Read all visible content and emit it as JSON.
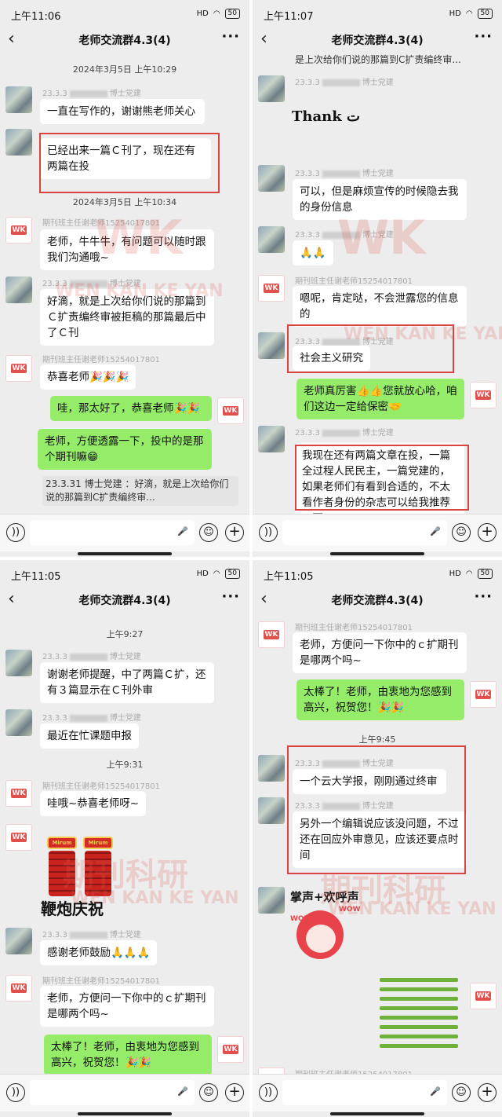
{
  "status": {
    "p1_time": "上午11:06",
    "p2_time": "上午11:07",
    "p3_time": "上午11:05",
    "p4_time": "上午11:05",
    "battery": "50",
    "net": "HD"
  },
  "header": {
    "title": "老师交流群4.3(4)",
    "back": "‹",
    "more": "···"
  },
  "input": {
    "mic": "🎤",
    "emoji": "☺",
    "plus": "+",
    "voice": "))"
  },
  "watermark": {
    "wk": "WK",
    "pinyin": "WEN KAN KE YAN",
    "cn": "期刊科研",
    "logo": "WK"
  },
  "sender_names": {
    "member": "23.3.3",
    "member_suffix": "博士党建",
    "teacher": "期刊班主任谢老师15254017801",
    "teacher_short": "期刊班主任谢老师"
  },
  "p1": {
    "ts1": "2024年3月5日 上午10:29",
    "m1": "一直在写作的，谢谢熊老师关心",
    "m2": "已经出来一篇Ｃ刊了，现在还有两篇在投",
    "ts2": "2024年3月5日 上午10:34",
    "m3": "老师，牛牛牛，有问题可以随时跟我们沟通哦~",
    "m4": "好滴，就是上次给你们说的那篇到Ｃ扩责编终审被拒稿的那篇最后中了Ｃ刊",
    "m5": "恭喜老师🎉🎉🎉",
    "m6": "哇，那太好了，恭喜老师🎉🎉",
    "m7": "老师，方便透露一下，投中的是那个期刊嘛😁",
    "quote": "23.3.31  博士党建  ：好滴，就是上次给你们说的那篇到C扩责编终审..."
  },
  "p2": {
    "top_quote": "是上次给你们说的那篇到C扩责编终审...",
    "sticker": "Thank ت",
    "m1": "可以，但是麻烦宣传的时候隐去我的身份信息",
    "m2": "🙏🙏",
    "m3": "嗯呢，肯定哒，不会泄露您的信息的",
    "m4": "社会主义研究",
    "m5": "老师真厉害👍👍您就放心哈，咱们这边一定给保密🤝",
    "m6": "我现在还有两篇文章在投，一篇全过程人民民主，一篇党建的，如果老师们有看到合适的，不太看作者身份的杂志可以给我推荐一下"
  },
  "p3": {
    "ts1": "上午9:27",
    "m1": "谢谢老师提醒，中了两篇Ｃ扩，还有３篇显示在Ｃ刊外审",
    "m2": "最近在忙课题申报",
    "ts2": "上午9:31",
    "m3": "哇哦~恭喜老师呀~",
    "sticker": "鞭炮庆祝",
    "fc_label": "Mirum",
    "m4": "感谢老师鼓励🙏🙏🙏",
    "m5": "老师，方便问一下你中的ｃ扩期刊是哪两个吗~",
    "m6": "太棒了！老师，由衷地为您感到高兴，祝贺您！🎉🎉"
  },
  "p4": {
    "m1": "老师，方便问一下你中的ｃ扩期刊是哪两个吗~",
    "m2": "太棒了！老师，由衷地为您感到高兴，祝贺您！🎉🎉",
    "ts1": "上午9:45",
    "m3": "一个云大学报，刚刚通过终审",
    "m4": "另外一个编辑说应该没问题，不过还在回应外审意见，应该还要点时间",
    "sticker": "掌声+欢呼声",
    "wow": "WOW"
  }
}
